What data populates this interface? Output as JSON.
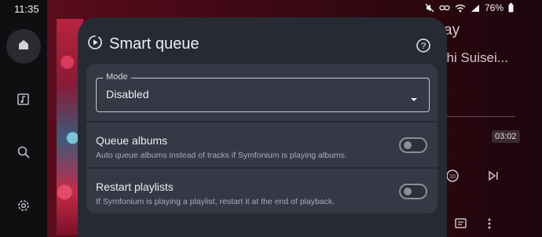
{
  "status_bar": {
    "time": "11:35",
    "battery": "76%"
  },
  "background": {
    "title_fragment": "ay",
    "artist_fragment": "chi Suisei...",
    "track_duration": "03:02"
  },
  "dialog": {
    "title": "Smart queue",
    "mode": {
      "label": "Mode",
      "value": "Disabled"
    },
    "options": [
      {
        "title": "Queue albums",
        "subtitle": "Auto queue albums instead of tracks if Symfonium is playing albums.",
        "enabled": false
      },
      {
        "title": "Restart playlists",
        "subtitle": "If Symfonium is playing a playlist, restart it at the end of playback.",
        "enabled": false
      }
    ]
  },
  "colors": {
    "dialog_bg": "#262a33",
    "card_bg": "#353945",
    "background_accent": "#5a0c1c"
  }
}
